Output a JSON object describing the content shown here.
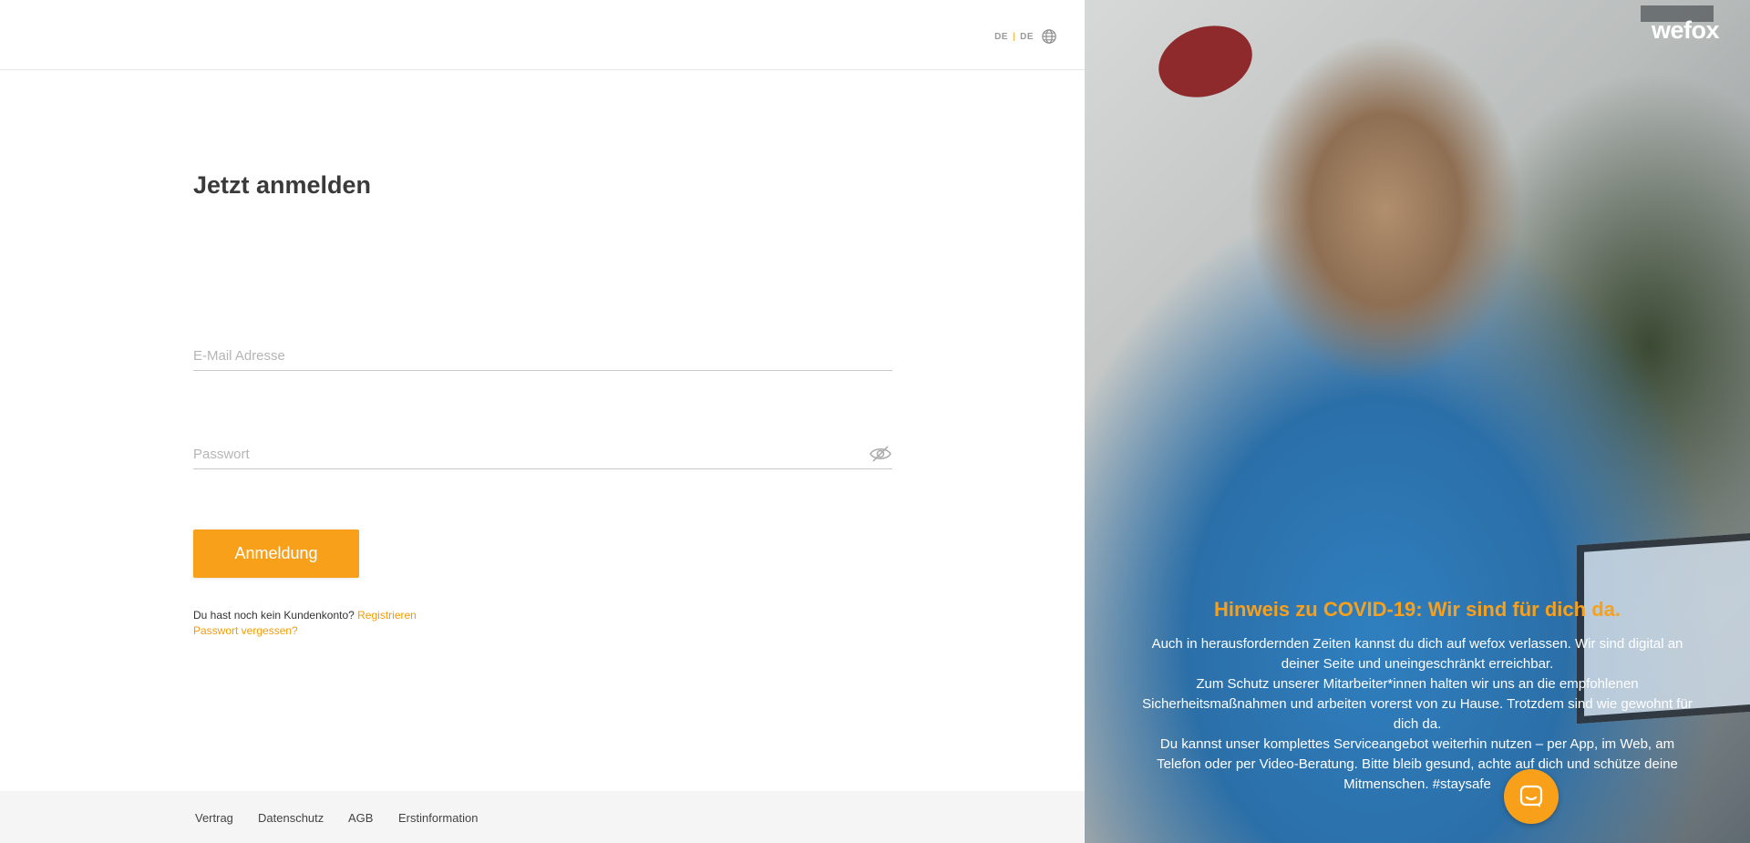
{
  "language": {
    "current": "DE",
    "separator": "|",
    "alt": "DE",
    "icon": "globe-icon"
  },
  "login": {
    "title": "Jetzt anmelden",
    "email_placeholder": "E-Mail Adresse",
    "password_placeholder": "Passwort",
    "password_toggle_icon": "eye-slash-icon",
    "submit_label": "Anmeldung",
    "no_account_text": "Du hast noch kein Kundenkonto?",
    "register_label": "Registrieren",
    "forgot_label": "Passwort vergessen?"
  },
  "footer": {
    "links": [
      "Vertrag",
      "Datenschutz",
      "AGB",
      "Erstinformation"
    ]
  },
  "hero": {
    "logo": "wefox",
    "heading": "Hinweis zu COVID-19: Wir sind für dich da.",
    "paragraphs": [
      "Auch in herausfordernden Zeiten kannst du dich auf wefox verlassen. Wir sind digital an deiner Seite und uneingeschränkt erreichbar.",
      "Zum Schutz unserer Mitarbeiter*innen halten wir uns an die empfohlenen Sicherheitsmaßnahmen und arbeiten vorerst von zu Hause. Trotzdem sind wie gewohnt für dich da.",
      "Du kannst unser komplettes Serviceangebot weiterhin nutzen – per App, im Web, am Telefon oder per Video-Beratung. Bitte bleib gesund, achte auf dich und schütze deine Mitmenschen. #staysafe"
    ]
  },
  "chat": {
    "icon": "chat-icon"
  },
  "colors": {
    "accent": "#f9a01b",
    "footer_bg": "#f5f5f5",
    "heading": "#3a3a3a"
  }
}
